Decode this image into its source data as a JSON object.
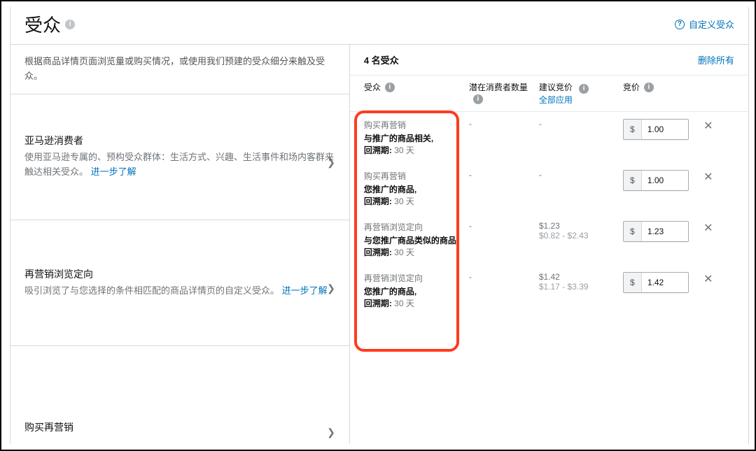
{
  "header": {
    "title": "受众",
    "custom_audience_label": "自定义受众"
  },
  "left": {
    "intro": "根据商品详情页面浏览量或购买情况，或使用我们预建的受众细分来触及受众。",
    "section1_title": "亚马逊消费者",
    "section1_desc": "使用亚马逊专属的、预构受众群体：生活方式、兴趣、生活事件和场内客群来触达相关受众。",
    "section2_title": "再营销浏览定向",
    "section2_desc": "吸引浏览了与您选择的条件相匹配的商品详情页的自定义受众。",
    "learn_more": "进一步了解",
    "bottom_section_title": "购买再营销"
  },
  "right": {
    "count_label": "4 名受众",
    "remove_all": "删除所有",
    "columns": {
      "audience": "受众",
      "potential": "潜在消费者数量",
      "suggested": "建议竞价",
      "apply_all": "全部应用",
      "bid": "竞价"
    },
    "currency_symbol": "$",
    "lookback_label": "回溯期:",
    "rows": [
      {
        "category": "购买再营销",
        "main": "与推广的商品相关,",
        "lookback_value": "30 天",
        "potential": "-",
        "suggested_main": "-",
        "suggested_range": "",
        "bid": "1.00"
      },
      {
        "category": "购买再营销",
        "main": "您推广的商品,",
        "lookback_value": "30 天",
        "potential": "-",
        "suggested_main": "-",
        "suggested_range": "",
        "bid": "1.00"
      },
      {
        "category": "再营销浏览定向",
        "main": "与您推广商品类似的商品,",
        "lookback_value": "30 天",
        "potential": "-",
        "suggested_main": "$1.23",
        "suggested_range": "$0.82 - $2.43",
        "bid": "1.23"
      },
      {
        "category": "再营销浏览定向",
        "main": "您推广的商品,",
        "lookback_value": "30 天",
        "potential": "-",
        "suggested_main": "$1.42",
        "suggested_range": "$1.17 - $3.39",
        "bid": "1.42"
      }
    ]
  }
}
